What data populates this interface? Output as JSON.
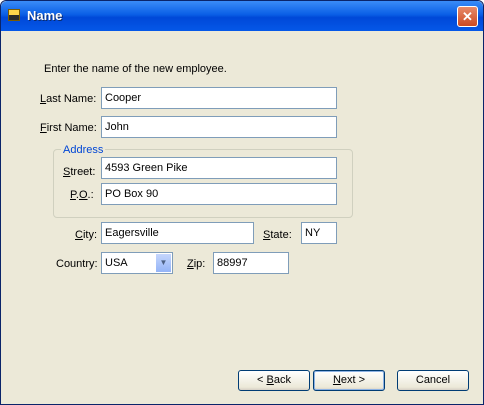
{
  "window": {
    "title": "Name",
    "close_glyph": "✕"
  },
  "prompt": "Enter the name of the new employee.",
  "last_name": {
    "label_u": "L",
    "label_rest": "ast Name:",
    "value": "Cooper"
  },
  "first_name": {
    "label_u": "F",
    "label_rest": "irst Name:",
    "value": "John"
  },
  "address": {
    "group_title": "Address",
    "street": {
      "label_u": "S",
      "label_rest": "treet:",
      "value": "4593 Green Pike"
    },
    "po": {
      "label_u": "P",
      "label_mid": ".",
      "label_u2": "O",
      "label_rest": ".:",
      "value": "PO Box 90"
    }
  },
  "city": {
    "label_u": "C",
    "label_rest": "ity:",
    "value": "Eagersville"
  },
  "state": {
    "label_u": "S",
    "label_rest": "tate:",
    "value": "NY"
  },
  "country": {
    "label": "Country:",
    "value": "USA"
  },
  "zip": {
    "label_u": "Z",
    "label_rest": "ip:",
    "value": "88997"
  },
  "buttons": {
    "back": {
      "prefix": "< ",
      "u": "B",
      "rest": "ack"
    },
    "next": {
      "u": "N",
      "rest": "ext",
      "suffix": " >"
    },
    "cancel": "Cancel"
  },
  "icons": {
    "title_icon": "app-icon",
    "combo_arrow": "chevron-down-icon",
    "close": "close-icon"
  },
  "colors": {
    "titlebar": "#0a5fe6",
    "dialog_bg": "#ece9d8",
    "group_title": "#0046d5",
    "field_border": "#7f9db9"
  }
}
